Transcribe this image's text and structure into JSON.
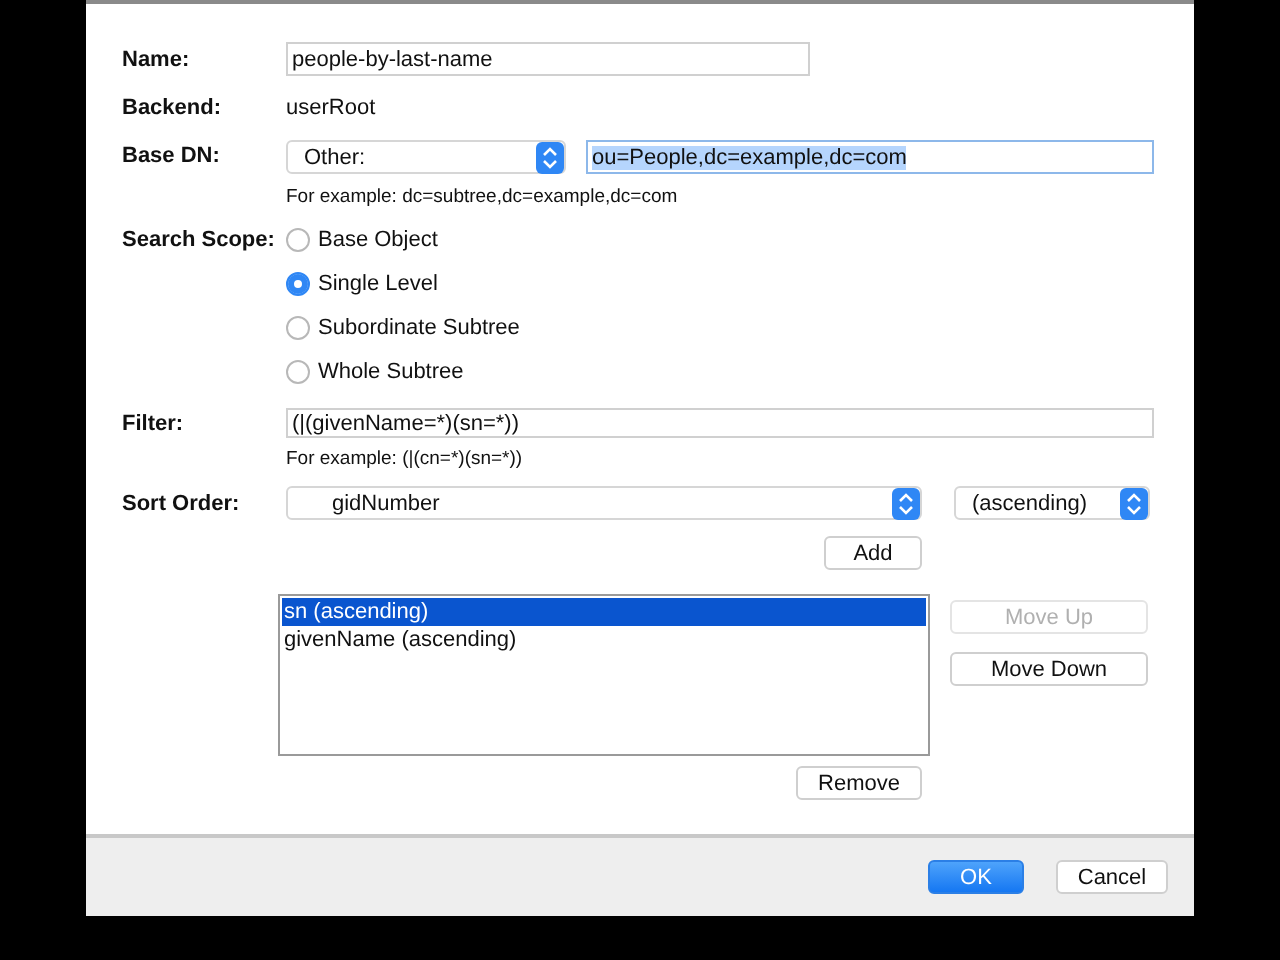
{
  "form": {
    "name": {
      "label": "Name:",
      "value": "people-by-last-name"
    },
    "backend": {
      "label": "Backend:",
      "value": "userRoot"
    },
    "base_dn": {
      "label": "Base DN:",
      "option": "Other:",
      "value": "ou=People,dc=example,dc=com",
      "text_selected": true,
      "example": "For example: dc=subtree,dc=example,dc=com"
    },
    "search_scope": {
      "label": "Search Scope:",
      "options": [
        {
          "label": "Base Object",
          "selected": false
        },
        {
          "label": "Single Level",
          "selected": true
        },
        {
          "label": "Subordinate Subtree",
          "selected": false
        },
        {
          "label": "Whole Subtree",
          "selected": false
        }
      ]
    },
    "filter": {
      "label": "Filter:",
      "value": "(|(givenName=*)(sn=*))",
      "example": "For example: (|(cn=*)(sn=*))"
    },
    "sort_order": {
      "label": "Sort Order:",
      "attribute": "gidNumber",
      "direction": "(ascending)",
      "add": "Add",
      "list": [
        {
          "label": "sn (ascending)",
          "selected": true
        },
        {
          "label": "givenName (ascending)",
          "selected": false
        }
      ],
      "buttons": [
        {
          "label": "Move Up",
          "disabled": true
        },
        {
          "label": "Move Down",
          "disabled": false
        }
      ],
      "remove": "Remove"
    }
  },
  "footer": {
    "buttons": [
      {
        "label": "OK",
        "default": true
      },
      {
        "label": "Cancel",
        "default": false
      }
    ]
  }
}
